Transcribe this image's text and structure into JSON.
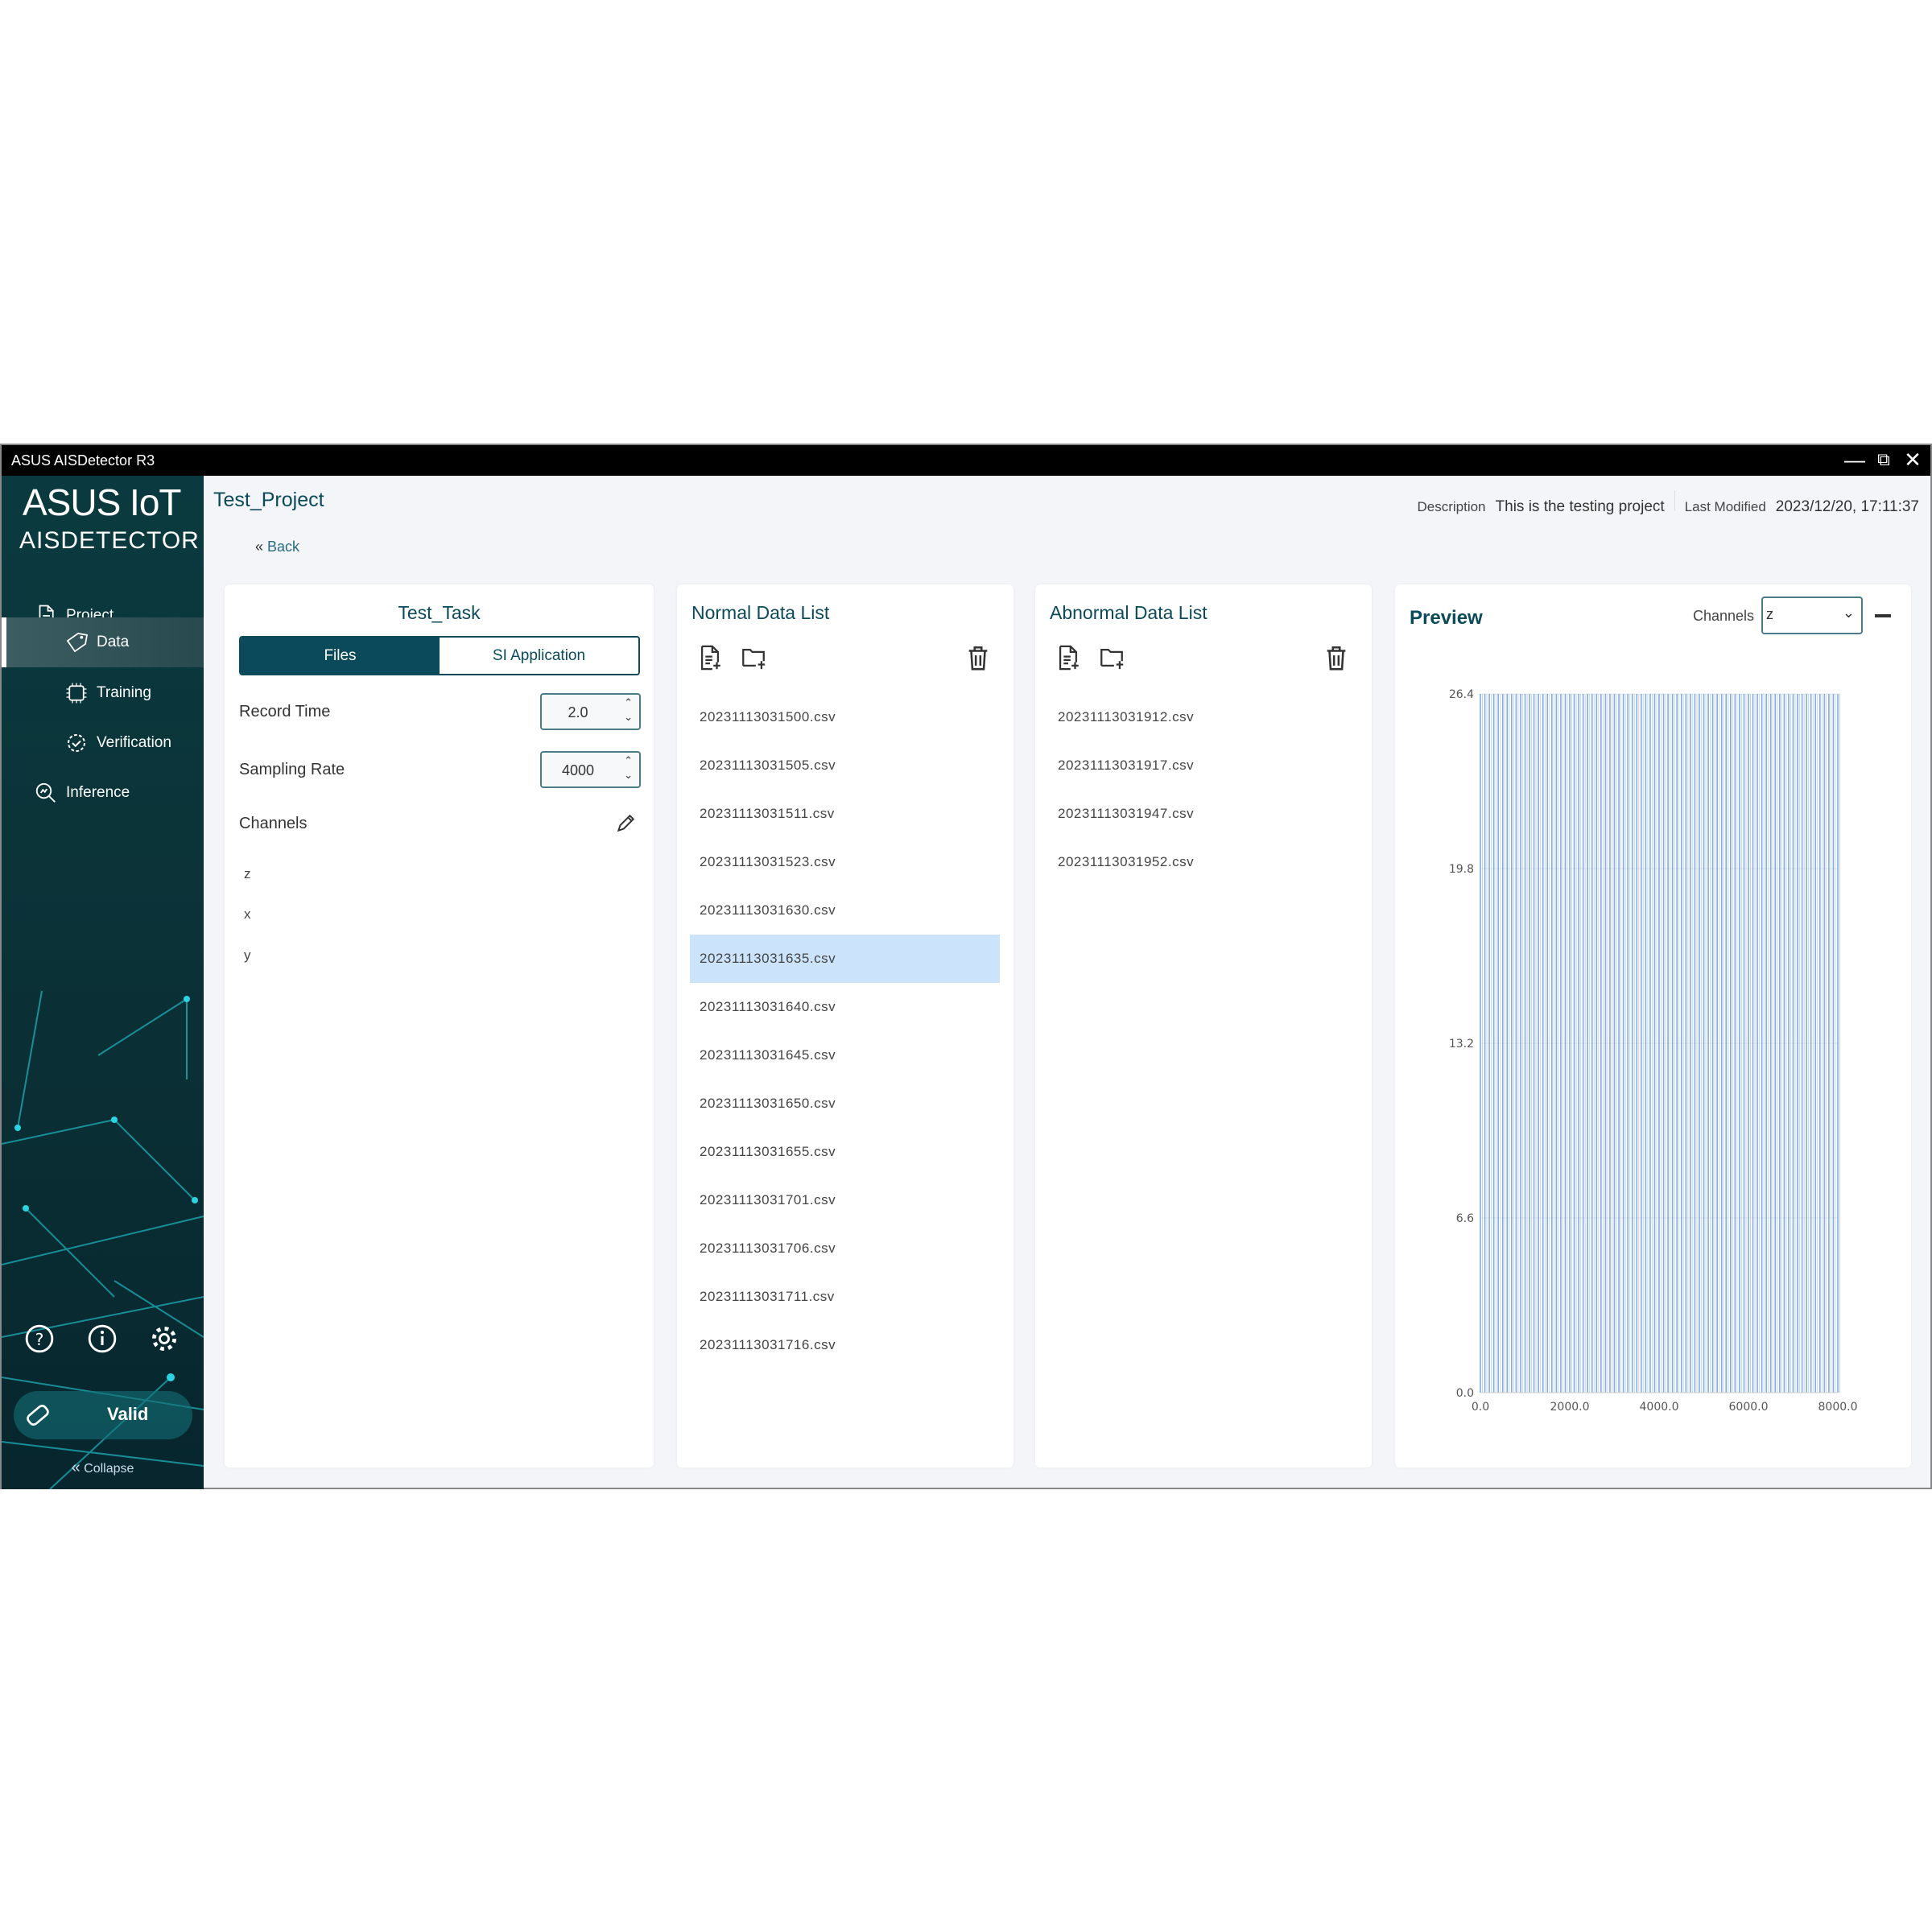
{
  "window": {
    "title": "ASUS AISDetector R3",
    "controls": [
      "minimize",
      "restore",
      "close"
    ]
  },
  "sidebar": {
    "logo_line1": "ASUS IoT",
    "logo_line2": "AISDETECTOR",
    "items": [
      {
        "label": "Project",
        "icon": "document-icon"
      },
      {
        "label": "Data",
        "icon": "tag-icon",
        "active": true
      },
      {
        "label": "Training",
        "icon": "chip-icon"
      },
      {
        "label": "Verification",
        "icon": "gear-check-icon"
      },
      {
        "label": "Inference",
        "icon": "search-chart-icon"
      }
    ],
    "bottom_icons": [
      "help-icon",
      "info-icon",
      "settings-icon"
    ],
    "license_status": "Valid",
    "collapse_label": "Collapse"
  },
  "header": {
    "project_title": "Test_Project",
    "description_label": "Description",
    "description": "This is the testing project",
    "modified_label": "Last Modified",
    "modified": "2023/12/20, 17:11:37",
    "back_label": "Back"
  },
  "task": {
    "title": "Test_Task",
    "tabs": [
      "Files",
      "SI Application"
    ],
    "active_tab": "Files",
    "record_time_label": "Record Time",
    "record_time": "2.0",
    "sampling_rate_label": "Sampling Rate",
    "sampling_rate": "4000",
    "channels_label": "Channels",
    "channels": [
      "z",
      "x",
      "y"
    ]
  },
  "normal_list": {
    "title": "Normal Data List",
    "selected": "20231113031635.csv",
    "files": [
      "20231113031500.csv",
      "20231113031505.csv",
      "20231113031511.csv",
      "20231113031523.csv",
      "20231113031630.csv",
      "20231113031635.csv",
      "20231113031640.csv",
      "20231113031645.csv",
      "20231113031650.csv",
      "20231113031655.csv",
      "20231113031701.csv",
      "20231113031706.csv",
      "20231113031711.csv",
      "20231113031716.csv"
    ]
  },
  "abnormal_list": {
    "title": "Abnormal Data List",
    "files": [
      "20231113031912.csv",
      "20231113031917.csv",
      "20231113031947.csv",
      "20231113031952.csv"
    ]
  },
  "preview": {
    "title": "Preview",
    "channels_label": "Channels",
    "channel_selected": "z"
  },
  "chart_data": {
    "type": "line",
    "color": "#5b8fd9",
    "grid": true,
    "xlim": [
      0,
      8000
    ],
    "ylim": [
      0,
      26.4
    ],
    "x_ticks": [
      "0.0",
      "2000.0",
      "4000.0",
      "6000.0",
      "8000.0"
    ],
    "y_ticks": [
      "0.0",
      "6.6",
      "13.2",
      "19.8",
      "26.4"
    ],
    "spike_x": [
      0,
      100,
      200,
      300,
      400,
      500,
      600,
      700,
      800,
      900,
      1000,
      1100,
      1200,
      1300,
      1400,
      1500,
      1600,
      1700,
      1800,
      1900,
      2000,
      2100,
      2200,
      2300,
      2400,
      2500,
      2600,
      2700,
      2800,
      2900,
      3000,
      3100,
      3200,
      3300,
      3400,
      3500,
      3600,
      3700,
      3800,
      3900,
      4000,
      4100,
      4200,
      4300,
      4400,
      4500,
      4600,
      4700,
      4800,
      4900,
      5000,
      5100,
      5200,
      5300,
      5400,
      5500,
      5600,
      5700,
      5800,
      5900,
      6000,
      6100,
      6200,
      6300,
      6400,
      6500,
      6600,
      6700,
      6800,
      6900,
      7000,
      7100,
      7200,
      7300,
      7400,
      7500,
      7600,
      7700,
      7800,
      7900,
      8000
    ],
    "spike_low": 0,
    "spike_high": 26.4
  }
}
